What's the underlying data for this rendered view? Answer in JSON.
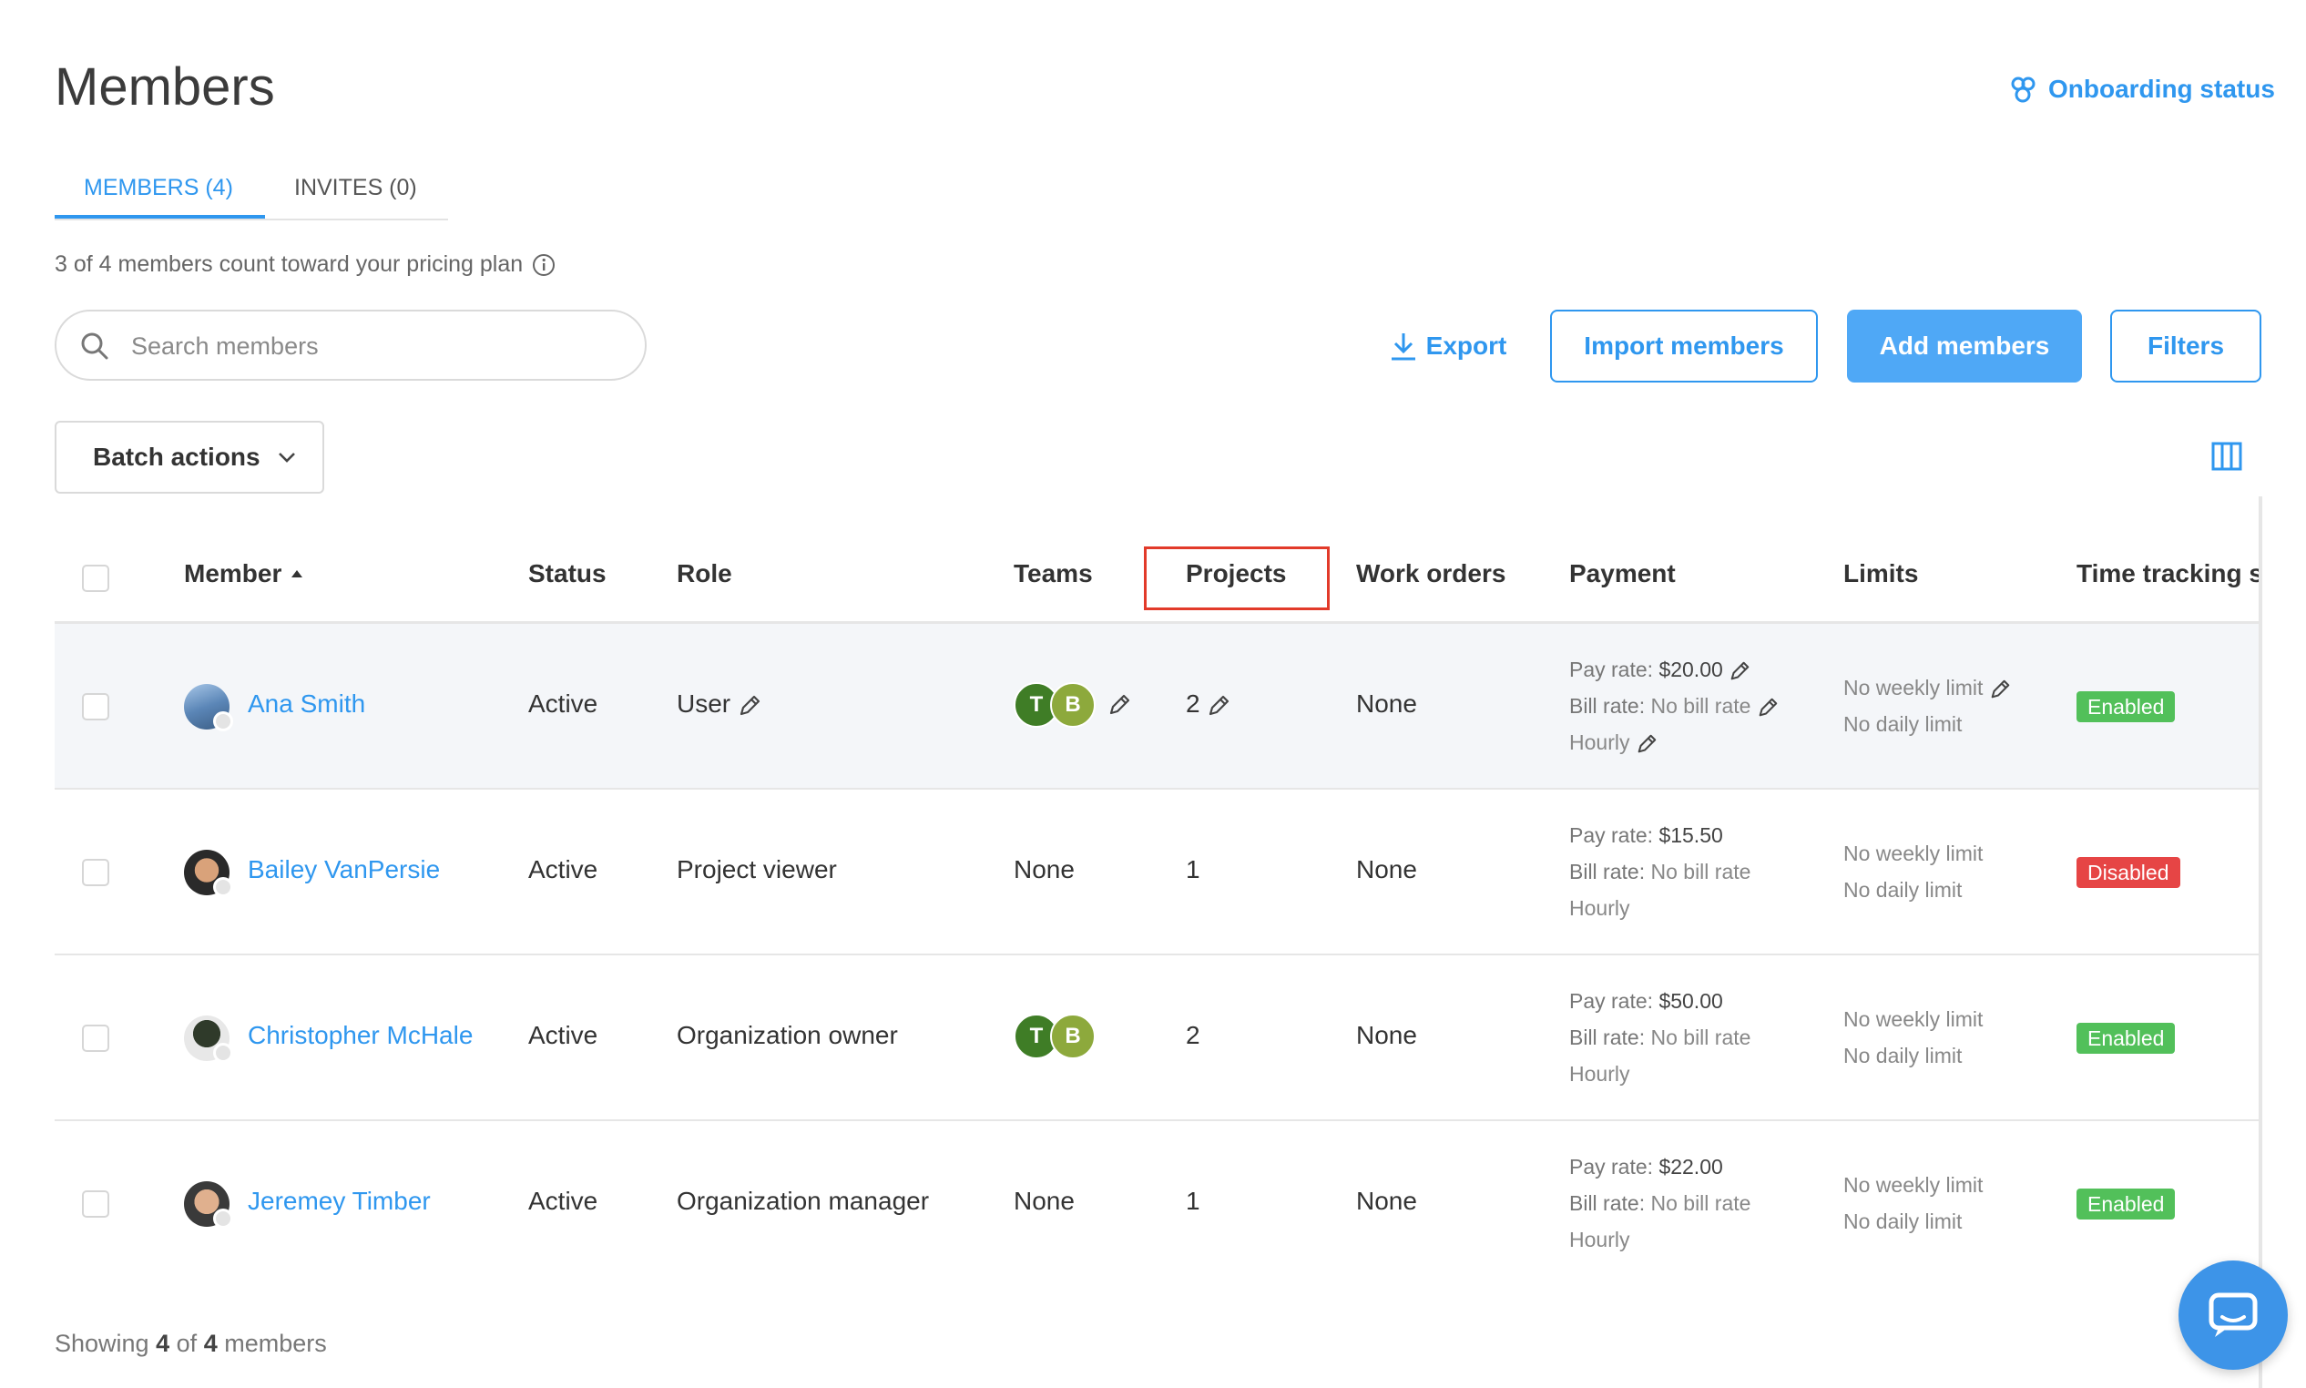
{
  "page": {
    "title": "Members",
    "onboarding_label": "Onboarding status"
  },
  "tabs": [
    {
      "label": "MEMBERS (4)"
    },
    {
      "label": "INVITES (0)"
    }
  ],
  "plan_note": "3 of 4 members count toward your pricing plan",
  "search": {
    "placeholder": "Search members"
  },
  "toolbar": {
    "export_label": "Export",
    "import_label": "Import members",
    "add_label": "Add members",
    "filters_label": "Filters",
    "batch_label": "Batch actions"
  },
  "columns": [
    "Member",
    "Status",
    "Role",
    "Teams",
    "Projects",
    "Work orders",
    "Payment",
    "Limits",
    "Time tracking st"
  ],
  "rows": [
    {
      "name": "Ana Smith",
      "status": "Active",
      "role": "User",
      "teams": [
        "T",
        "B"
      ],
      "teams_text": "",
      "projects": "2",
      "work_orders": "None",
      "pay_rate_label": "Pay rate:",
      "pay_rate": "$20.00",
      "bill_rate_label": "Bill rate:",
      "bill_rate": "No bill rate",
      "pay_type": "Hourly",
      "weekly": "No weekly limit",
      "daily": "No daily limit",
      "tracking": "Enabled"
    },
    {
      "name": "Bailey VanPersie",
      "status": "Active",
      "role": "Project viewer",
      "teams": [],
      "teams_text": "None",
      "projects": "1",
      "work_orders": "None",
      "pay_rate_label": "Pay rate:",
      "pay_rate": "$15.50",
      "bill_rate_label": "Bill rate:",
      "bill_rate": "No bill rate",
      "pay_type": "Hourly",
      "weekly": "No weekly limit",
      "daily": "No daily limit",
      "tracking": "Disabled"
    },
    {
      "name": "Christopher McHale",
      "status": "Active",
      "role": "Organization owner",
      "teams": [
        "T",
        "B"
      ],
      "teams_text": "",
      "projects": "2",
      "work_orders": "None",
      "pay_rate_label": "Pay rate:",
      "pay_rate": "$50.00",
      "bill_rate_label": "Bill rate:",
      "bill_rate": "No bill rate",
      "pay_type": "Hourly",
      "weekly": "No weekly limit",
      "daily": "No daily limit",
      "tracking": "Enabled"
    },
    {
      "name": "Jeremey Timber",
      "status": "Active",
      "role": "Organization manager",
      "teams": [],
      "teams_text": "None",
      "projects": "1",
      "work_orders": "None",
      "pay_rate_label": "Pay rate:",
      "pay_rate": "$22.00",
      "bill_rate_label": "Bill rate:",
      "bill_rate": "No bill rate",
      "pay_type": "Hourly",
      "weekly": "No weekly limit",
      "daily": "No daily limit",
      "tracking": "Enabled"
    }
  ],
  "footer": {
    "prefix": "Showing",
    "shown": "4",
    "of": "of",
    "total": "4",
    "suffix": "members"
  },
  "colors": {
    "accent": "#2f97ef",
    "enabled": "#52c05a",
    "disabled": "#e64545",
    "highlight": "#e23a2a"
  }
}
